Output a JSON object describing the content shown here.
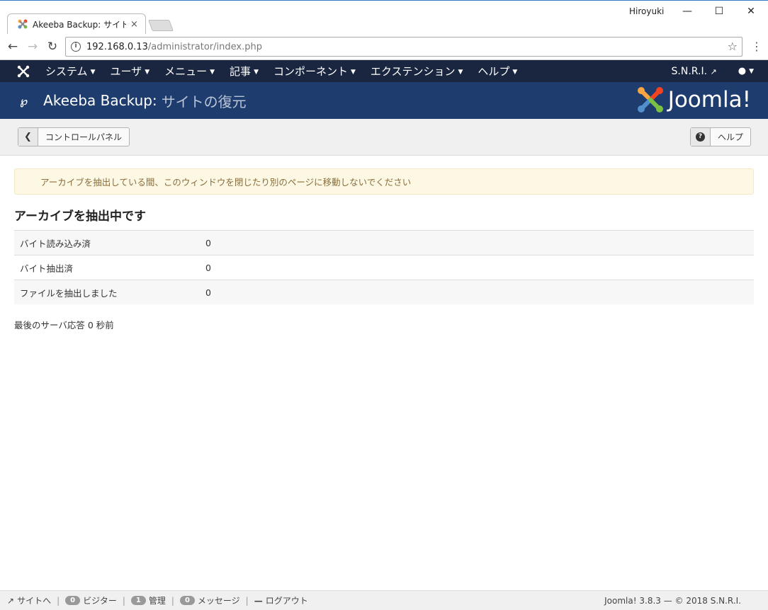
{
  "browser": {
    "tab_title": "Akeeba Backup: サイトの復",
    "tab_close": "×",
    "user_name": "Hiroyuki",
    "url_host": "192.168.0.13",
    "url_path": "/administrator/index.php"
  },
  "topnav": {
    "items": [
      {
        "label": "システム"
      },
      {
        "label": "ユーザ"
      },
      {
        "label": "メニュー"
      },
      {
        "label": "記事"
      },
      {
        "label": "コンポーネント"
      },
      {
        "label": "エクステンション"
      },
      {
        "label": "ヘルプ"
      }
    ],
    "site_name": "S.N.R.I."
  },
  "header": {
    "title": "Akeeba Backup:",
    "subtitle": "サイトの復元",
    "brand": "Joomla!"
  },
  "toolbar": {
    "back_label": "コントロールパネル",
    "help_label": "ヘルプ"
  },
  "main": {
    "alert": "アーカイブを抽出している間、このウィンドウを閉じたり別のページに移動しないでください",
    "heading": "アーカイブを抽出中です",
    "rows": [
      {
        "label": "バイト読み込み済",
        "value": "0"
      },
      {
        "label": "バイト抽出済",
        "value": "0"
      },
      {
        "label": "ファイルを抽出しました",
        "value": "0"
      }
    ],
    "last_response": "最後のサーバ応答 0 秒前"
  },
  "footer": {
    "site_link": "サイトへ",
    "visitors_count": "0",
    "visitors_label": "ビジター",
    "admin_count": "1",
    "admin_label": "管理",
    "messages_count": "0",
    "messages_label": "メッセージ",
    "logout_label": "ログアウト",
    "version": "Joomla! 3.8.3 — © 2018 S.N.R.I."
  },
  "colors": {
    "topnav_bg": "#1a2640",
    "header_bg": "#1e3d6e",
    "alert_bg": "#fcf8e3",
    "alert_text": "#8a6d3b"
  }
}
